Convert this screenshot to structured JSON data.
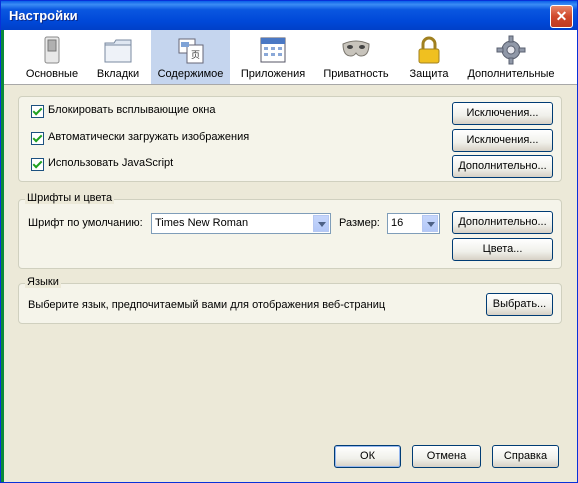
{
  "window": {
    "title": "Настройки"
  },
  "toolbar": {
    "items": [
      {
        "label": "Основные",
        "icon": "switch-icon"
      },
      {
        "label": "Вкладки",
        "icon": "folder-icon"
      },
      {
        "label": "Содержимое",
        "icon": "content-icon",
        "selected": true
      },
      {
        "label": "Приложения",
        "icon": "calendar-icon"
      },
      {
        "label": "Приватность",
        "icon": "mask-icon"
      },
      {
        "label": "Защита",
        "icon": "lock-icon"
      },
      {
        "label": "Дополнительные",
        "icon": "gear-icon"
      }
    ]
  },
  "content": {
    "popups": {
      "label": "Блокировать всплывающие окна",
      "checked": true,
      "button": "Исключения..."
    },
    "images": {
      "label": "Автоматически загружать изображения",
      "checked": true,
      "button": "Исключения..."
    },
    "javascript": {
      "label": "Использовать JavaScript",
      "checked": true,
      "button": "Дополнительно..."
    }
  },
  "fonts": {
    "group_label": "Шрифты и цвета",
    "default_font_label": "Шрифт по умолчанию:",
    "default_font_value": "Times New Roman",
    "size_label": "Размер:",
    "size_value": "16",
    "advanced_button": "Дополнительно...",
    "colors_button": "Цвета..."
  },
  "languages": {
    "group_label": "Языки",
    "description": "Выберите язык, предпочитаемый вами для отображения веб-страниц",
    "choose_button": "Выбрать..."
  },
  "footer": {
    "ok": "ОК",
    "cancel": "Отмена",
    "help": "Справка"
  }
}
